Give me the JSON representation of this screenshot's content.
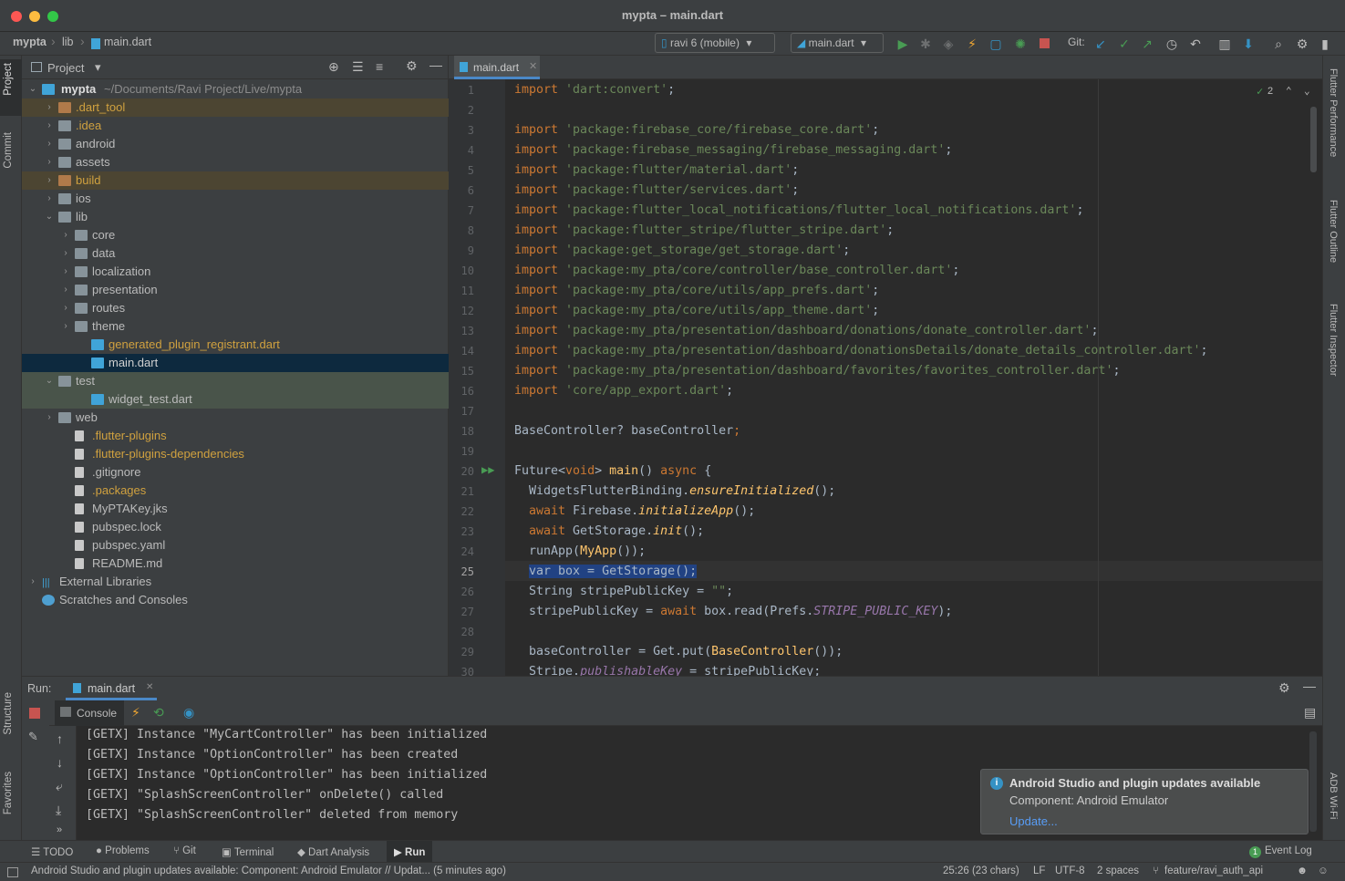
{
  "window": {
    "title": "mypta – main.dart"
  },
  "nav": {
    "breadcrumbs": [
      "mypta",
      "lib",
      "main.dart"
    ],
    "device": "ravi 6 (mobile)",
    "run_config": "main.dart",
    "git_label": "Git:"
  },
  "left_strip": {
    "project": "Project",
    "commit": "Commit",
    "structure": "Structure",
    "favorites": "Favorites"
  },
  "right_strip": {
    "flutter_performance": "Flutter Performance",
    "flutter_outline": "Flutter Outline",
    "flutter_inspector": "Flutter Inspector",
    "adb_wifi": "ADB Wi-Fi"
  },
  "project": {
    "title": "Project",
    "root_name": "mypta",
    "root_path": "~/Documents/Ravi Project/Live/mypta",
    "items": [
      {
        "label": ".dart_tool",
        "depth": 1,
        "arrow": "›",
        "kind": "folder-or",
        "color": "#d0a13f",
        "bg": "#4c4532"
      },
      {
        "label": ".idea",
        "depth": 1,
        "arrow": "›",
        "kind": "folder",
        "color": "#d0a13f",
        "bg": ""
      },
      {
        "label": "android",
        "depth": 1,
        "arrow": "›",
        "kind": "folder",
        "color": "#bbbbbb",
        "bg": ""
      },
      {
        "label": "assets",
        "depth": 1,
        "arrow": "›",
        "kind": "folder",
        "color": "#bbbbbb",
        "bg": ""
      },
      {
        "label": "build",
        "depth": 1,
        "arrow": "›",
        "kind": "folder-or",
        "color": "#d0a13f",
        "bg": "#4c4532"
      },
      {
        "label": "ios",
        "depth": 1,
        "arrow": "›",
        "kind": "folder",
        "color": "#bbbbbb",
        "bg": ""
      },
      {
        "label": "lib",
        "depth": 1,
        "arrow": "⌄",
        "kind": "folder",
        "color": "#bbbbbb",
        "bg": ""
      },
      {
        "label": "core",
        "depth": 2,
        "arrow": "›",
        "kind": "folder",
        "color": "#bbbbbb",
        "bg": ""
      },
      {
        "label": "data",
        "depth": 2,
        "arrow": "›",
        "kind": "folder",
        "color": "#bbbbbb",
        "bg": ""
      },
      {
        "label": "localization",
        "depth": 2,
        "arrow": "›",
        "kind": "folder",
        "color": "#bbbbbb",
        "bg": ""
      },
      {
        "label": "presentation",
        "depth": 2,
        "arrow": "›",
        "kind": "folder",
        "color": "#bbbbbb",
        "bg": ""
      },
      {
        "label": "routes",
        "depth": 2,
        "arrow": "›",
        "kind": "folder",
        "color": "#bbbbbb",
        "bg": ""
      },
      {
        "label": "theme",
        "depth": 2,
        "arrow": "›",
        "kind": "folder",
        "color": "#bbbbbb",
        "bg": ""
      },
      {
        "label": "generated_plugin_registrant.dart",
        "depth": 3,
        "arrow": "",
        "kind": "dartf",
        "color": "#d0a13f",
        "bg": ""
      },
      {
        "label": "main.dart",
        "depth": 3,
        "arrow": "",
        "kind": "dartf",
        "color": "#d0d0d0",
        "bg": "#0d293e"
      },
      {
        "label": "test",
        "depth": 1,
        "arrow": "⌄",
        "kind": "folder",
        "color": "#bbbbbb",
        "bg": "#49544a"
      },
      {
        "label": "widget_test.dart",
        "depth": 3,
        "arrow": "",
        "kind": "dartf",
        "color": "#bbbbbb",
        "bg": "#49544a"
      },
      {
        "label": "web",
        "depth": 1,
        "arrow": "›",
        "kind": "folder",
        "color": "#bbbbbb",
        "bg": ""
      },
      {
        "label": ".flutter-plugins",
        "depth": 2,
        "arrow": "",
        "kind": "file",
        "color": "#d0a13f",
        "bg": ""
      },
      {
        "label": ".flutter-plugins-dependencies",
        "depth": 2,
        "arrow": "",
        "kind": "file",
        "color": "#d0a13f",
        "bg": ""
      },
      {
        "label": ".gitignore",
        "depth": 2,
        "arrow": "",
        "kind": "file",
        "color": "#bbbbbb",
        "bg": ""
      },
      {
        "label": ".packages",
        "depth": 2,
        "arrow": "",
        "kind": "file",
        "color": "#d0a13f",
        "bg": ""
      },
      {
        "label": "MyPTAKey.jks",
        "depth": 2,
        "arrow": "",
        "kind": "file",
        "color": "#bbbbbb",
        "bg": ""
      },
      {
        "label": "pubspec.lock",
        "depth": 2,
        "arrow": "",
        "kind": "file",
        "color": "#bbbbbb",
        "bg": ""
      },
      {
        "label": "pubspec.yaml",
        "depth": 2,
        "arrow": "",
        "kind": "file",
        "color": "#bbbbbb",
        "bg": ""
      },
      {
        "label": "README.md",
        "depth": 2,
        "arrow": "",
        "kind": "file",
        "color": "#bbbbbb",
        "bg": ""
      },
      {
        "label": "External Libraries",
        "depth": 0,
        "arrow": "›",
        "kind": "lib",
        "color": "#bbbbbb",
        "bg": ""
      },
      {
        "label": "Scratches and Consoles",
        "depth": 0,
        "arrow": "",
        "kind": "scratch",
        "color": "#bbbbbb",
        "bg": ""
      }
    ]
  },
  "editor": {
    "tab_label": "main.dart",
    "inspection_count": "2",
    "current_line": 25,
    "lines": [
      [
        [
          "kw",
          "import "
        ],
        [
          "str",
          "'dart:convert'"
        ],
        [
          "t",
          ";"
        ]
      ],
      [],
      [
        [
          "kw",
          "import "
        ],
        [
          "str",
          "'package:firebase_core/firebase_core.dart'"
        ],
        [
          "t",
          ";"
        ]
      ],
      [
        [
          "kw",
          "import "
        ],
        [
          "str",
          "'package:firebase_messaging/firebase_messaging.dart'"
        ],
        [
          "t",
          ";"
        ]
      ],
      [
        [
          "kw",
          "import "
        ],
        [
          "str",
          "'package:flutter/material.dart'"
        ],
        [
          "t",
          ";"
        ]
      ],
      [
        [
          "kw",
          "import "
        ],
        [
          "str",
          "'package:flutter/services.dart'"
        ],
        [
          "t",
          ";"
        ]
      ],
      [
        [
          "kw",
          "import "
        ],
        [
          "str",
          "'package:flutter_local_notifications/flutter_local_notifications.dart'"
        ],
        [
          "t",
          ";"
        ]
      ],
      [
        [
          "kw",
          "import "
        ],
        [
          "str",
          "'package:flutter_stripe/flutter_stripe.dart'"
        ],
        [
          "t",
          ";"
        ]
      ],
      [
        [
          "kw",
          "import "
        ],
        [
          "str",
          "'package:get_storage/get_storage.dart'"
        ],
        [
          "t",
          ";"
        ]
      ],
      [
        [
          "kw",
          "import "
        ],
        [
          "str",
          "'package:my_pta/core/controller/base_controller.dart'"
        ],
        [
          "t",
          ";"
        ]
      ],
      [
        [
          "kw",
          "import "
        ],
        [
          "str",
          "'package:my_pta/core/utils/app_prefs.dart'"
        ],
        [
          "t",
          ";"
        ]
      ],
      [
        [
          "kw",
          "import "
        ],
        [
          "str",
          "'package:my_pta/core/utils/app_theme.dart'"
        ],
        [
          "t",
          ";"
        ]
      ],
      [
        [
          "kw",
          "import "
        ],
        [
          "str",
          "'package:my_pta/presentation/dashboard/donations/donate_controller.dart'"
        ],
        [
          "t",
          ";"
        ]
      ],
      [
        [
          "kw",
          "import "
        ],
        [
          "str",
          "'package:my_pta/presentation/dashboard/donationsDetails/donate_details_controller.dart'"
        ],
        [
          "t",
          ";"
        ]
      ],
      [
        [
          "kw",
          "import "
        ],
        [
          "str",
          "'package:my_pta/presentation/dashboard/favorites/favorites_controller.dart'"
        ],
        [
          "t",
          ";"
        ]
      ],
      [
        [
          "kw",
          "import "
        ],
        [
          "str",
          "'core/app_export.dart'"
        ],
        [
          "t",
          ";"
        ]
      ],
      [],
      [
        [
          "t",
          "BaseController? baseController"
        ],
        [
          "kw",
          ";"
        ]
      ],
      [],
      [
        [
          "t",
          "Future<"
        ],
        [
          "kw",
          "void"
        ],
        [
          "t",
          "> "
        ],
        [
          "fn",
          "main"
        ],
        [
          "t",
          "() "
        ],
        [
          "kw",
          "async"
        ],
        [
          "t",
          " {"
        ]
      ],
      [
        [
          "t",
          "  WidgetsFlutterBinding."
        ],
        [
          "it",
          "ensureInitialized"
        ],
        [
          "t",
          "();"
        ]
      ],
      [
        [
          "kw",
          "  await "
        ],
        [
          "t",
          "Firebase."
        ],
        [
          "it",
          "initializeApp"
        ],
        [
          "t",
          "();"
        ]
      ],
      [
        [
          "kw",
          "  await "
        ],
        [
          "t",
          "GetStorage."
        ],
        [
          "it",
          "init"
        ],
        [
          "t",
          "();"
        ]
      ],
      [
        [
          "t",
          "  runApp("
        ],
        [
          "fn",
          "MyApp"
        ],
        [
          "t",
          "());"
        ]
      ],
      [
        [
          "t",
          "  "
        ],
        [
          "sel",
          "var box = GetStorage();"
        ]
      ],
      [
        [
          "t",
          "  String stripePublicKey = "
        ],
        [
          "str",
          "\"\""
        ],
        [
          "t",
          ";"
        ]
      ],
      [
        [
          "t",
          "  stripePublicKey = "
        ],
        [
          "kw",
          "await "
        ],
        [
          "t",
          "box.read(Prefs."
        ],
        [
          "const",
          "STRIPE_PUBLIC_KEY"
        ],
        [
          "t",
          ");"
        ]
      ],
      [],
      [
        [
          "t",
          "  baseController = Get.put("
        ],
        [
          "fn",
          "BaseController"
        ],
        [
          "t",
          "());"
        ]
      ],
      [
        [
          "t",
          "  Stripe."
        ],
        [
          "const",
          "publishableKey"
        ],
        [
          "t",
          " = stripePublicKey;"
        ]
      ]
    ]
  },
  "run": {
    "title": "Run:",
    "tab_label": "main.dart",
    "console_label": "Console",
    "lines": [
      "[GETX] Instance \"MyCartController\" has been initialized",
      "[GETX] Instance \"OptionController\" has been created",
      "[GETX] Instance \"OptionController\" has been initialized",
      "[GETX] \"SplashScreenController\" onDelete() called",
      "[GETX] \"SplashScreenController\" deleted from memory"
    ]
  },
  "notification": {
    "title": "Android Studio and plugin updates available",
    "body": "Component: Android Emulator",
    "action": "Update..."
  },
  "bottom_tabs": {
    "todo": "TODO",
    "problems": "Problems",
    "git": "Git",
    "terminal": "Terminal",
    "dart_analysis": "Dart Analysis",
    "run": "Run",
    "event_log": "Event Log",
    "event_count": "1"
  },
  "status": {
    "message": "Android Studio and plugin updates available: Component: Android Emulator // Updat... (5 minutes ago)",
    "position": "25:26 (23 chars)",
    "line_sep": "LF",
    "encoding": "UTF-8",
    "indent": "2 spaces",
    "branch": "feature/ravi_auth_api"
  },
  "colors": {
    "accent_green": "#499c54",
    "accent_blue": "#3592c4",
    "stop_red": "#c75450"
  }
}
